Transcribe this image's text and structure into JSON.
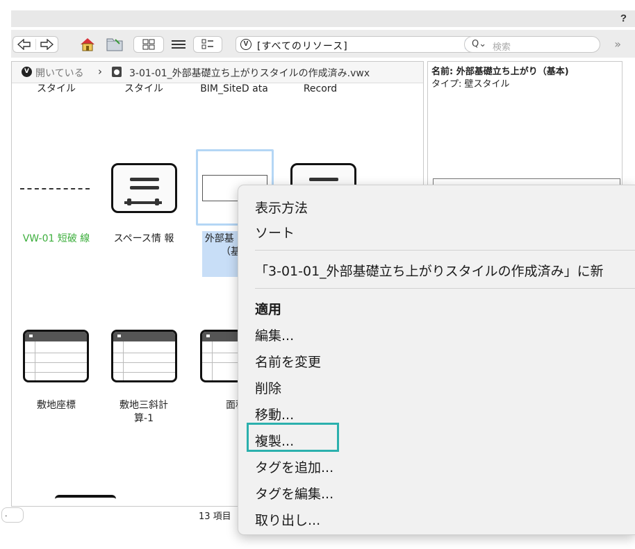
{
  "titlebar": {
    "help": "?"
  },
  "toolbar": {
    "select_value": "[すべてのリソース]",
    "select_icon": "V",
    "search_placeholder": "検索",
    "search_icon": "Q⌄",
    "more": "»"
  },
  "breadcrumb": {
    "open_icon": "V",
    "open_label": "開いている",
    "separator": "›",
    "file_name": "3-01-01_外部基礎立ち上がりスタイルの作成済み.vwx"
  },
  "resources": [
    {
      "label": "スタイル"
    },
    {
      "label": "スタイル"
    },
    {
      "label": "BIM_SiteD ata"
    },
    {
      "label": "Record"
    },
    {
      "label": "VW-01 短破 線"
    },
    {
      "label": "スペース情 報"
    },
    {
      "label": "外部基 ち上た （基本"
    },
    {
      "label": "敷地座標"
    },
    {
      "label": "敷地三斜計 算-1"
    },
    {
      "label": "面積"
    }
  ],
  "statusbar": {
    "count": "13 項目",
    "pill": "."
  },
  "info": {
    "name": "名前: 外部基礎立ち上がり（基本)",
    "type": "タイプ: 壁スタイル"
  },
  "context_menu": {
    "view": "表示方法",
    "sort": "ソート",
    "new_in": "「3-01-01_外部基礎立ち上がりスタイルの作成済み」に新",
    "apply": "適用",
    "edit": "編集...",
    "rename": "名前を変更",
    "delete": "削除",
    "move": "移動...",
    "duplicate": "複製...",
    "add_tag": "タグを追加...",
    "edit_tag": "タグを編集...",
    "extract": "取り出し..."
  },
  "colors": {
    "accent": "#2a7bf6",
    "highlight": "#2bb0ad",
    "selection": "#c8def7",
    "green_label": "#3cae3c"
  }
}
